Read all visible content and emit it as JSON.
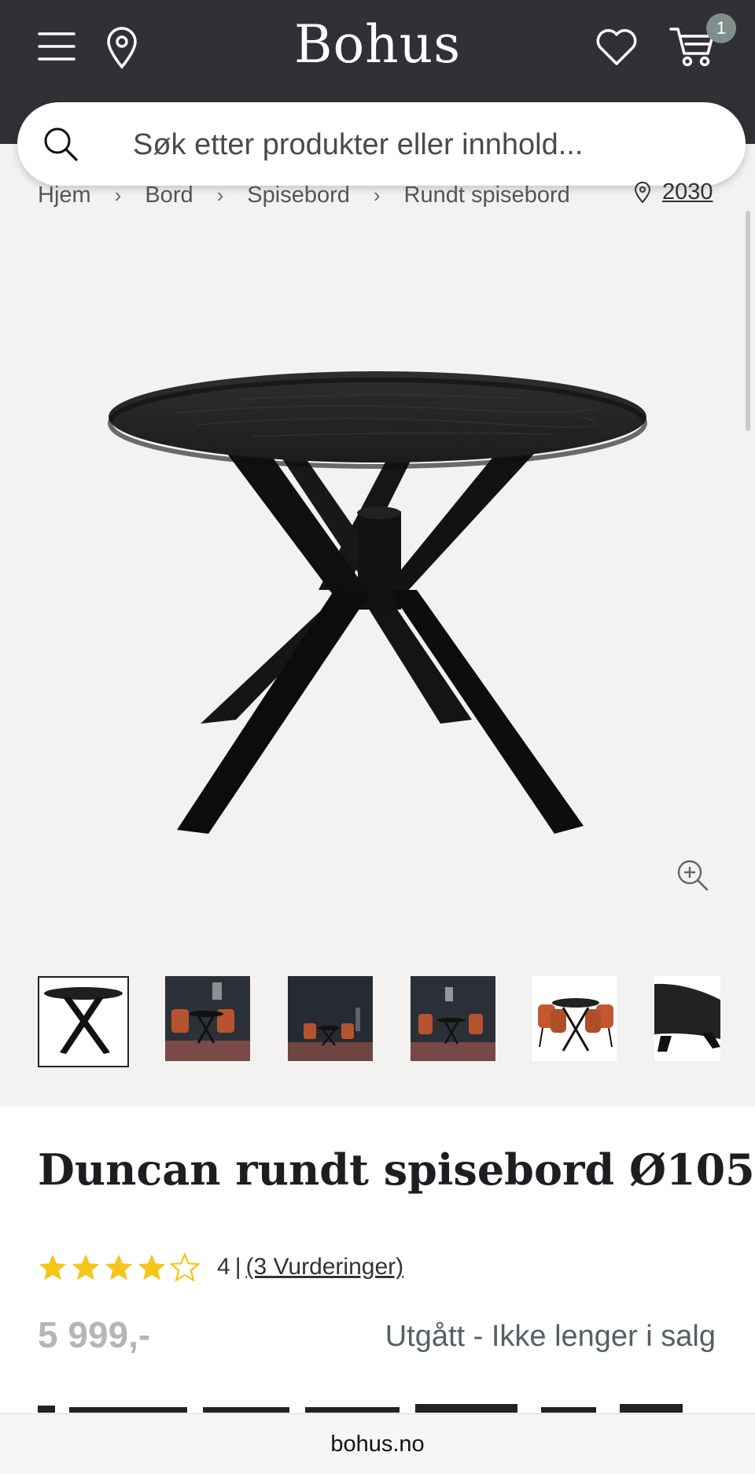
{
  "header": {
    "logo": "Bohus",
    "cart_count": "1"
  },
  "search": {
    "placeholder": "Søk etter produkter eller innhold..."
  },
  "breadcrumb": {
    "items": [
      "Hjem",
      "Bord",
      "Spisebord",
      "Rundt spisebord"
    ]
  },
  "location": {
    "postcode": "2030"
  },
  "product": {
    "title": "Duncan rundt spisebord Ø105",
    "rating_value": "4",
    "rating_bar": "|",
    "reviews_link": "(3 Vurderinger)",
    "stars_filled": 4,
    "stars_total": 5,
    "price": "5 999,-",
    "status": "Utgått - Ikke lenger i salg"
  },
  "colors": {
    "header_bg": "#313034",
    "star": "#f5c517",
    "gallery_bg": "#f3f2f0",
    "status_text": "#546163"
  },
  "footer": {
    "domain": "bohus.no"
  }
}
